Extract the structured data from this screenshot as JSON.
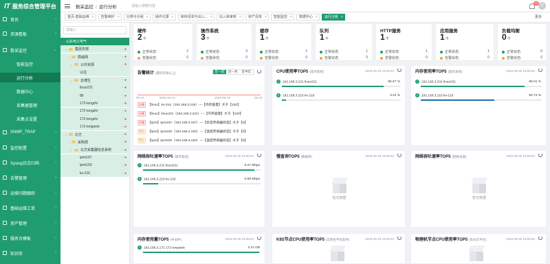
{
  "app": {
    "logo_prefix": "IT",
    "logo_title": "服务综合管理平台"
  },
  "sidebar": {
    "items": [
      {
        "label": "首页",
        "arrow": "›"
      },
      {
        "label": "资源看板",
        "arrow": "›"
      },
      {
        "label": "数采监控",
        "arrow": "⌄"
      },
      {
        "label": "智能监控"
      },
      {
        "label": "运行分析"
      },
      {
        "label": "数据中心"
      },
      {
        "label": "采集器管理"
      },
      {
        "label": "采集点设置"
      },
      {
        "label": "SNMP_TRAP",
        "arrow": "›"
      },
      {
        "label": "监控配置",
        "arrow": "›"
      },
      {
        "label": "Syslog日志归档",
        "arrow": "›"
      },
      {
        "label": "告警管理",
        "arrow": "›"
      },
      {
        "label": "运维问题跟踪",
        "arrow": "›"
      },
      {
        "label": "基础运维工单",
        "arrow": "›"
      },
      {
        "label": "资产管理",
        "arrow": "›"
      },
      {
        "label": "服务台模板",
        "arrow": "›"
      },
      {
        "label": "知识库",
        "arrow": "›"
      }
    ]
  },
  "topbar": {
    "crumb1": "数采监控",
    "crumb_sep": "/",
    "crumb2": "运行分析",
    "search_placeholder": "请输入搜索内容",
    "badge": "10",
    "avatar": "王"
  },
  "tabs": [
    {
      "label": "首页-基础运维"
    },
    {
      "label": "告警维护"
    },
    {
      "label": "分类与分组"
    },
    {
      "label": "操作记录"
    },
    {
      "label": "库存清单与出入..."
    },
    {
      "label": "出入库审核"
    },
    {
      "label": "资产清单"
    },
    {
      "label": "智能监控"
    },
    {
      "label": "数据中心"
    },
    {
      "label": "运行分析",
      "active": true
    }
  ],
  "tabs_more": "更多",
  "tree": {
    "search_placeholder": "请输入",
    "nodes": [
      {
        "label": "山东电工电气",
        "tog": "⌄"
      },
      {
        "label": "集团本部",
        "tog": "⌄",
        "dot": "●"
      },
      {
        "label": "局域网",
        "tog": "⌄",
        "dot": "●"
      },
      {
        "label": "公共资源",
        "tog": "⌄",
        "dot": "●"
      },
      {
        "label": "以往"
      },
      {
        "label": "云博生",
        "tog": "⌄",
        "dot": "●"
      },
      {
        "label": "linux231",
        "dot": "●"
      },
      {
        "label": "86",
        "dot": "●"
      },
      {
        "label": "172-tongzhi",
        "dot": "●"
      },
      {
        "label": "172-tongzhi",
        "dot": "●"
      },
      {
        "label": "172-tongzhi",
        "dot": "●"
      },
      {
        "label": "172-longweb",
        "dot": "●"
      },
      {
        "label": "北方",
        "tog": "⌄",
        "dot": "●"
      },
      {
        "label": "采购部",
        "tog": "⌄",
        "dot": "●"
      },
      {
        "label": "北方采集器信息系统",
        "tog": "⌄",
        "dot": "●"
      },
      {
        "label": "ipmi167",
        "dot": "●"
      },
      {
        "label": "ipmi150",
        "dot": "●"
      },
      {
        "label": "kv-216",
        "dot": "●"
      }
    ]
  },
  "stats": [
    {
      "title": "硬件",
      "num": "2",
      "unit": "个",
      "normal_label": "正常状态:",
      "normal": "2",
      "alarm_label": "告警状态:",
      "alarm": "0"
    },
    {
      "title": "操作系统",
      "num": "3",
      "unit": "个",
      "normal_label": "正常状态:",
      "normal": "3",
      "alarm_label": "告警状态:",
      "alarm": "0"
    },
    {
      "title": "缓存",
      "num": "1",
      "unit": "个",
      "normal_label": "正常状态:",
      "normal": "1",
      "alarm_label": "告警状态:",
      "alarm": "0"
    },
    {
      "title": "队列",
      "num": "1",
      "unit": "个",
      "normal_label": "正常状态:",
      "normal": "1",
      "alarm_label": "告警状态:",
      "alarm": "0"
    },
    {
      "title": "HTTP服务",
      "num": "1",
      "unit": "个",
      "normal_label": "正常状态:",
      "normal": "1",
      "alarm_label": "告警状态:",
      "alarm": "0"
    },
    {
      "title": "应用服务",
      "num": "1",
      "unit": "个",
      "normal_label": "正常状态:",
      "normal": "1",
      "alarm_label": "告警状态:",
      "alarm": "0"
    },
    {
      "title": "负载均衡",
      "num": "0",
      "unit": "个",
      "normal_label": "正常状态:",
      "normal": "0",
      "alarm_label": "告警状态:",
      "alarm": "0"
    }
  ],
  "alarms": {
    "title": "告警统计",
    "sub": "(最近有限以上)",
    "seg": [
      "近一周",
      "近一月",
      "近半年"
    ],
    "axis": [
      "08-19",
      "2026-08-21",
      "2026-08-23",
      "08-25"
    ],
    "events": [
      {
        "tag": "灾难",
        "text": "【linux】kv-216（192.168.3.216）—【内存容量】大于【100】",
        "sev": "r"
      },
      {
        "tag": "灾难",
        "text": "【linux】linux231（192.168.3.231）—【内存容量】大于【100】",
        "sev": "r"
      },
      {
        "tag": "灾难",
        "text": "【ipmi】ipmi167（192.168.3.167）—【状态传感器状态】大于【0】",
        "sev": "r"
      },
      {
        "tag": "警告",
        "text": "【ipmi】ipmi150（192.168.3.150）—【温度传感器状态】大于【0】",
        "sev": "o"
      },
      {
        "tag": "警告",
        "text": "【ipmi】ipmi150（192.168.3.150）—【温度传感器状态】大于【0】",
        "sev": "o"
      }
    ]
  },
  "cpu_top": {
    "title": "CPU使用率TOP5",
    "sub": "(操作系统)",
    "time": "2026-08-25 15:55:52",
    "items": [
      {
        "n": "1",
        "name": "192.168.3.231 linux231",
        "pct": "85.57 %",
        "val": 0.8557
      },
      {
        "n": "2",
        "name": "192.168.3.216 kv-216",
        "pct": "3.24 %",
        "val": 0.0324
      }
    ]
  },
  "mem_top": {
    "title": "内存使用率TOP5",
    "sub": "(操作系统)",
    "time": "2026-08-25 15:55:52",
    "items": [
      {
        "n": "1",
        "name": "192.168.3.231 linux231",
        "pct": "86.01 %",
        "val": 0.8601
      },
      {
        "n": "2",
        "name": "192.168.3.216 kv-216",
        "pct": "60.74 %",
        "val": 0.6074
      }
    ]
  },
  "net_top": {
    "title": "网络吞吐速率TOP5",
    "sub": "(操作系统)",
    "time": "2026-08-25 15:55:52",
    "items": [
      {
        "n": "1",
        "name": "192.168.3.231 linux231",
        "pct": "5.27 Mbps",
        "val": 0.95
      },
      {
        "n": "2",
        "name": "192.168.3.216 kv-216",
        "pct": "0.69 Mbps",
        "val": 0.13
      }
    ]
  },
  "disk_top": {
    "title": "慢查询TOP5",
    "sub": "(数据库)",
    "time": "2026-08-25 15:55:52",
    "empty": "暂无数据"
  },
  "net_dev": {
    "title": "网络吞吐速率TOP5",
    "sub": "(网络设备)",
    "time": "2026-08-25 15:55:52",
    "empty": "暂无数据"
  },
  "mem_rate": {
    "title": "内存使用量TOP5",
    "sub": "(中间件)",
    "time": "2026-08-25 15:55:52",
    "items": [
      {
        "n": "1",
        "name": "192.168.3.172 172-tongweb",
        "pct": "2.12 GB",
        "val": 0.99
      }
    ]
  },
  "k8s": {
    "title": "K8S节点CPU使用率TOP5",
    "sub": "(云原生平台软件)",
    "time": "2026-08-25 15:55:52"
  },
  "phys": {
    "title": "物理机节点CPU使用率TOP5",
    "sub": "(私有云平台)",
    "time": "2026-08-25 15:55:52"
  },
  "colors": {
    "primary": "#1f9d6e",
    "bar_blue": "#1f6fb5"
  }
}
